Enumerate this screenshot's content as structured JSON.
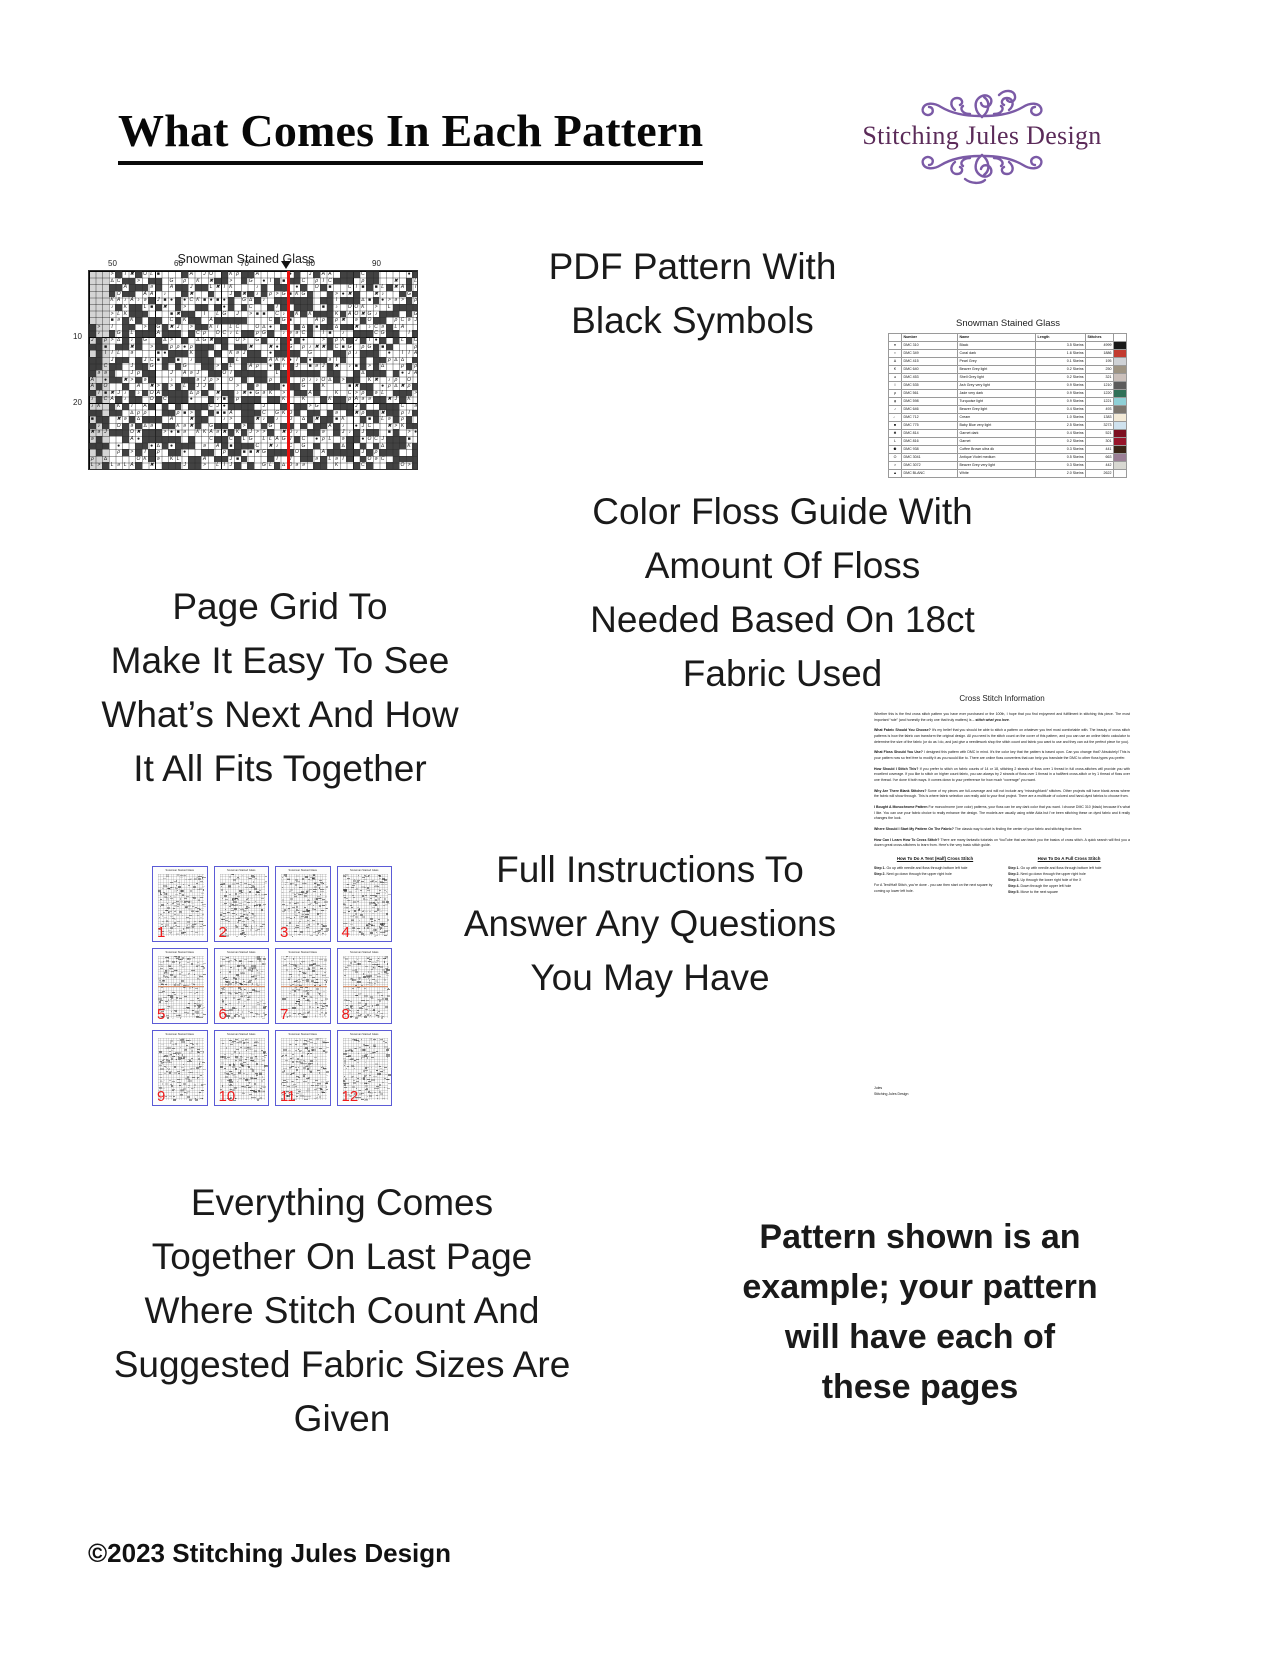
{
  "header": {
    "title": "What Comes In Each Pattern",
    "logo": {
      "brand": "Stitching Jules Design",
      "flourish_color": "#7b5aa6",
      "word_color": "#5b2b59"
    }
  },
  "captions": {
    "pdf_pattern": "PDF Pattern With\nBlack Symbols",
    "page_grid": "Page Grid To\nMake It Easy To See\nWhat’s Next And How\nIt All Fits Together",
    "floss_guide": "Color Floss Guide With\nAmount Of Floss\nNeeded Based On 18ct\nFabric Used",
    "instructions": "Full Instructions To\nAnswer Any Questions\nYou May Have",
    "last_page": "Everything Comes\nTogether On Last Page\nWhere Stitch Count And\nSuggested Fabric Sizes Are\nGiven",
    "disclaimer": "Pattern shown is an\nexample; your pattern\nwill have each of\nthese pages"
  },
  "copyright": "©2023 Stitching Jules Design",
  "chart": {
    "title": "Snowman Stained Glass",
    "column_labels": [
      "50",
      "60",
      "70",
      "80",
      "90"
    ],
    "row_labels": [
      "10",
      "20"
    ],
    "center_line_color": "#e8110f"
  },
  "floss_table": {
    "title": "Snowman Stained Glass",
    "columns": [
      "",
      "Number",
      "Name",
      "Length",
      "Stitches",
      ""
    ],
    "rows": [
      {
        "symbol": "●",
        "number": "DMC   310",
        "name": "Black",
        "length": "3.5 Skeins",
        "stitches": "4999",
        "color": "#1a1a1a"
      },
      {
        "symbol": "▪",
        "number": "DMC   349",
        "name": "Coral dark",
        "length": "1.6 Skeins",
        "stitches": "1886",
        "color": "#c23b30"
      },
      {
        "symbol": "∆",
        "number": "DMC   415",
        "name": "Pearl Grey",
        "length": "0.1 Skeins",
        "stitches": "195",
        "color": "#cfd2d6"
      },
      {
        "symbol": "€",
        "number": "DMC   640",
        "name": "Beaver Grey light",
        "length": "0.2 Skeins",
        "stitches": "250",
        "color": "#9e9483"
      },
      {
        "symbol": "ə",
        "number": "DMC   453",
        "name": "Shell Grey light",
        "length": "0.2 Skeins",
        "stitches": "321",
        "color": "#cbc0bb"
      },
      {
        "symbol": "I",
        "number": "DMC   535",
        "name": "Ash Grey very light",
        "length": "0.9 Skeins",
        "stitches": "1210",
        "color": "#5c5c5c"
      },
      {
        "symbol": "ρ",
        "number": "DMC   561",
        "name": "Jade very dark",
        "length": "0.9 Skeins",
        "stitches": "1220",
        "color": "#2f7057"
      },
      {
        "symbol": "φ",
        "number": "DMC   598",
        "name": "Turquoise light",
        "length": "0.9 Skeins",
        "stitches": "1221",
        "color": "#8fd0d6"
      },
      {
        "symbol": "♪",
        "number": "DMC   646",
        "name": "Beaver Grey light",
        "length": "0.4 Skeins",
        "stitches": "493",
        "color": "#7c766e"
      },
      {
        "symbol": "♩",
        "number": "DMC   712",
        "name": "Cream",
        "length": "1.0 Skeins",
        "stitches": "1383",
        "color": "#f3ead7"
      },
      {
        "symbol": "■",
        "number": "DMC   775",
        "name": "Baby Blue very light",
        "length": "2.5 Skeins",
        "stitches": "3273",
        "color": "#cfe2ee"
      },
      {
        "symbol": "✖",
        "number": "DMC   814",
        "name": "Garnet dark",
        "length": "0.4 Skeins",
        "stitches": "521",
        "color": "#7d1021"
      },
      {
        "symbol": "L",
        "number": "DMC   816",
        "name": "Garnet",
        "length": "0.2 Skeins",
        "stitches": "301",
        "color": "#97152a"
      },
      {
        "symbol": "⚈",
        "number": "DMC   938",
        "name": "Coffee Brown ultra dk",
        "length": "0.3 Skeins",
        "stitches": "441",
        "color": "#3b2416"
      },
      {
        "symbol": "O",
        "number": "DMC   3041",
        "name": "Antique Violet medium",
        "length": "0.5 Skeins",
        "stitches": "663",
        "color": "#9b7f96"
      },
      {
        "symbol": ">",
        "number": "DMC   3072",
        "name": "Beaver Grey very light",
        "length": "0.3 Skeins",
        "stitches": "442",
        "color": "#d8d8d2"
      },
      {
        "symbol": "▲",
        "number": "DMC   BLANC",
        "name": "White",
        "length": "2.0 Skeins",
        "stitches": "2622",
        "color": "#fdfdfd"
      }
    ]
  },
  "page_grid": {
    "thumb_title": "Snowman Stained Glass",
    "numbers": [
      "1",
      "2",
      "3",
      "4",
      "5",
      "6",
      "7",
      "8",
      "9",
      "10",
      "11",
      "12"
    ],
    "border_color": "#5b5bd6",
    "number_color": "#ef1b1b"
  },
  "instructions_sheet": {
    "title": "Cross Stitch Information",
    "intro": "Whether this is the first cross stitch pattern you have ever purchased or the 100th, I hope that you find enjoyment and fulfillment in stitching this piece. The most important “rule” (and honestly the only one that truly matters) is – stitch what you love.",
    "paragraphs": [
      {
        "heading": "What Fabric Should You Choose?",
        "text": " It’s my belief that you should be able to stitch a pattern on whatever you feel most comfortable with. The beauty of cross stitch patterns is how the fabric can transform the original design.  All you need is the stitch count on the cover of this pattern, and you can use an online fabric calculator to determine the size of the fabric (or do as I do, and just give a needlework shop the stitch count and fabric you want to use and they can cut the perfect piece for you)."
      },
      {
        "heading": "What Floss Should You Use?",
        "text": " I designed this pattern with DMC in mind. It’s the color key that the pattern is based upon. Can you change that? Absolutely! This is your pattern now so feel free to modify it as you would like to.  There are online floss converters that can help you translate the DMC to other floss types you prefer."
      },
      {
        "heading": "How Should I Stitch This?",
        "text": " If you prefer to stitch on fabric counts of 14 or 18, stitching 2 strands of floss over 1 thread in full cross-stitches will provide you with excellent coverage. If you like to stitch on higher count fabric, you can always try 2 strands of floss over 1 thread in a half/tent cross-stitch or try 1 thread of floss over one thread. I’ve done it both ways. It comes down to your preference for how much “coverage” you want."
      },
      {
        "heading": "Why Are There Blank Stitches?",
        "text": " Some of my pieces are full-coverage and will not include any “missing/blank” stitches. Other projects will have blank areas where the fabric will show through. This is where fabric selection can really add to your final project. There are a multitude of colored and hand-dyed fabrics to choose from."
      },
      {
        "heading": "I Bought A Monochrome Pattern",
        "text": " For monochrome (one color) patterns, your floss can be any dark color that you want. I choose DMC 310 (black) because it’s what I like. You can use your fabric choice to really enhance the design. The models are usually using white Aida but I’ve been stitching these on dyed fabric and it really changes the look."
      },
      {
        "heading": "Where Should I Start My Pattern On The Fabric?",
        "text": " The classic way to start is finding the center of your fabric and stitching from there."
      },
      {
        "heading": "How Can I Learn How To Cross Stitch?",
        "text": " There are many fantastic tutorials on YouTube that can teach you the basics of cross stitch. A quick search will find you a dozen great cross-stitchers to learn from. Here’s the very basic stitch guide."
      }
    ],
    "tent_stitch": {
      "heading": "How To Do A Tent (Half) Cross Stitch",
      "steps": [
        "Step 1. Go up with needle and floss through bottom left hole",
        "Step 2. Next go down through the upper right hole"
      ],
      "note": "For A Tent/Half Stitch, you’re done - you can then start on the next square by coming up lower left hole."
    },
    "full_stitch": {
      "heading": "How To Do A Full Cross Stitch",
      "steps": [
        "Step 1. Go up with needle and floss through bottom left hole",
        "Step 2. Next go down through the upper right hole",
        "Step 3. Up through the lower right hole of the X",
        "Step 4. Down through the upper left hole",
        "Step 5. Move to the next square"
      ]
    },
    "signature": "Jules\nStitching Jules Design"
  }
}
